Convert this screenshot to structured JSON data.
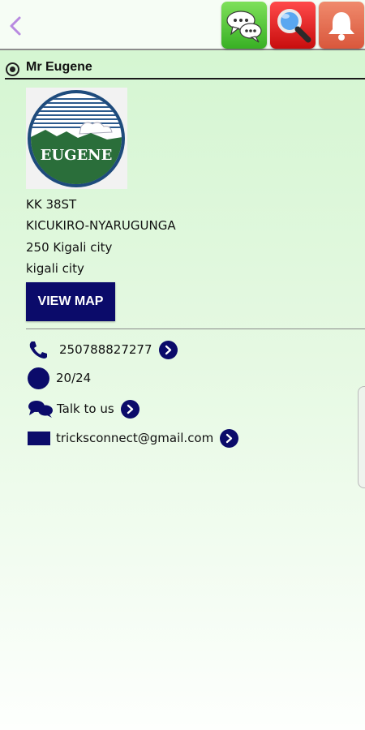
{
  "header": {
    "back_icon": "chevron-left-icon",
    "actions": [
      {
        "icon": "chat-bubbles-icon"
      },
      {
        "icon": "magnifier-icon"
      },
      {
        "icon": "bell-icon"
      }
    ],
    "colors": {
      "chat": "#38b024",
      "search": "#c80d0d",
      "bell": "#d9573c"
    }
  },
  "profile": {
    "name": "Mr Eugene",
    "logo_text": "EUGENE",
    "address": [
      "KK 38ST",
      "KICUKIRO-NYARUGUNGA",
      "250 Kigali city",
      "kigali city"
    ],
    "view_map_label": "VIEW MAP"
  },
  "contacts": {
    "phone": "250788827277",
    "hours": "20/24",
    "talk": "Talk to us",
    "email": "tricksconnect@gmail.com"
  },
  "theme": {
    "accent": "#0b0b6a",
    "background": "#d2f5cf"
  }
}
